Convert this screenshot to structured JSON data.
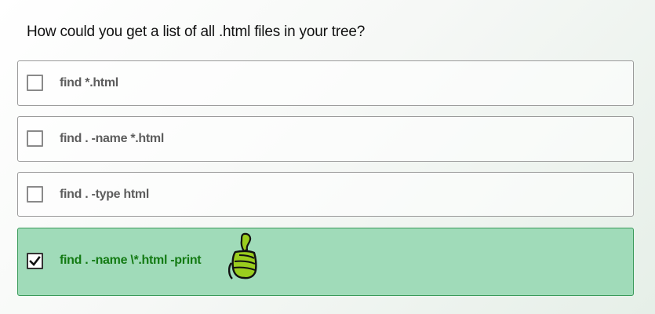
{
  "question": {
    "text": "How could you get a list of all .html files in your tree?"
  },
  "options": [
    {
      "label": "find *.html",
      "checked": false,
      "correct": false
    },
    {
      "label": "find . -name *.html",
      "checked": false,
      "correct": false
    },
    {
      "label": "find . -type html",
      "checked": false,
      "correct": false
    },
    {
      "label": "find . -name \\*.html -print",
      "checked": true,
      "correct": true
    }
  ],
  "feedback": {
    "icon": "thumbs-up-icon"
  },
  "colors": {
    "correct_background": "#a0dbb9",
    "correct_border": "#3a9a5a",
    "correct_text": "#137a13",
    "thumb_fill": "#9acd1e",
    "default_text": "#5d5d5d"
  }
}
